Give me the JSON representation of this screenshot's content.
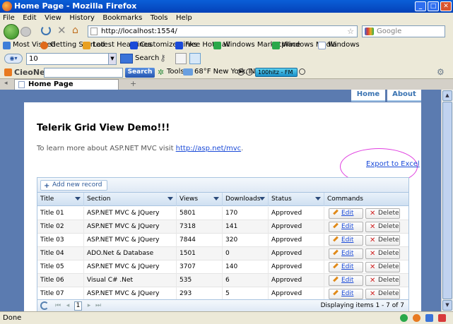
{
  "window": {
    "title": "Home Page - Mozilla Firefox",
    "min": "_",
    "max": "□",
    "close": "✕"
  },
  "menu": [
    "File",
    "Edit",
    "View",
    "History",
    "Bookmarks",
    "Tools",
    "Help"
  ],
  "nav": {
    "address": "http://localhost:1554/",
    "search_placeholder": "Google"
  },
  "bookmarks": [
    {
      "label": "Most Visited",
      "color": "#3e7ed8"
    },
    {
      "label": "Getting Started",
      "color": "#e06a1a"
    },
    {
      "label": "Latest Headlines",
      "color": "#e8a020"
    },
    {
      "label": "Customize Links",
      "color": "#1a4ad8"
    },
    {
      "label": "Free Hotmail",
      "color": "#1a4ad8"
    },
    {
      "label": "Windows Marketplace",
      "color": "#2aa84a"
    },
    {
      "label": "Windows Media",
      "color": "#2aa84a"
    },
    {
      "label": "Windows",
      "color": "#8aa0c8"
    }
  ],
  "toolbar1": {
    "zoom_value": "10",
    "search_label": "Search"
  },
  "toolbar2": {
    "brand": "CieoNet",
    "search_button": "Search",
    "tools": "Tools",
    "weather": "68°F New York, NY",
    "radio": "100hitz - FM"
  },
  "tab": {
    "label": "Home Page",
    "new_tab": "+"
  },
  "site_nav": {
    "home": "Home",
    "about": "About"
  },
  "page": {
    "title": "Telerik Grid View Demo!!!",
    "intro_text": "To learn more about ASP.NET MVC visit ",
    "intro_link": "http://asp.net/mvc",
    "intro_end": ".",
    "export": "Export to Excel"
  },
  "grid": {
    "add_label": "Add new record",
    "columns": [
      "Title",
      "Section",
      "Views",
      "Downloads",
      "Status",
      "Commands"
    ],
    "edit_label": "Edit",
    "delete_label": "Delete",
    "rows": [
      [
        "Title 01",
        "ASP.NET MVC & JQuery",
        "5801",
        "170",
        "Approved"
      ],
      [
        "Title 02",
        "ASP.NET MVC & JQuery",
        "7318",
        "141",
        "Approved"
      ],
      [
        "Title 03",
        "ASP.NET MVC & JQuery",
        "7844",
        "320",
        "Approved"
      ],
      [
        "Title 04",
        "ADO.Net & Database",
        "1501",
        "0",
        "Approved"
      ],
      [
        "Title 05",
        "ASP.NET MVC & JQuery",
        "3707",
        "140",
        "Approved"
      ],
      [
        "Title 06",
        "Visual C# .Net",
        "535",
        "6",
        "Approved"
      ],
      [
        "Title 07",
        "ASP.NET MVC & JQuery",
        "293",
        "5",
        "Approved"
      ]
    ],
    "pager": {
      "current": "1",
      "info": "Displaying items 1 - 7 of 7"
    }
  },
  "status": {
    "text": "Done"
  }
}
